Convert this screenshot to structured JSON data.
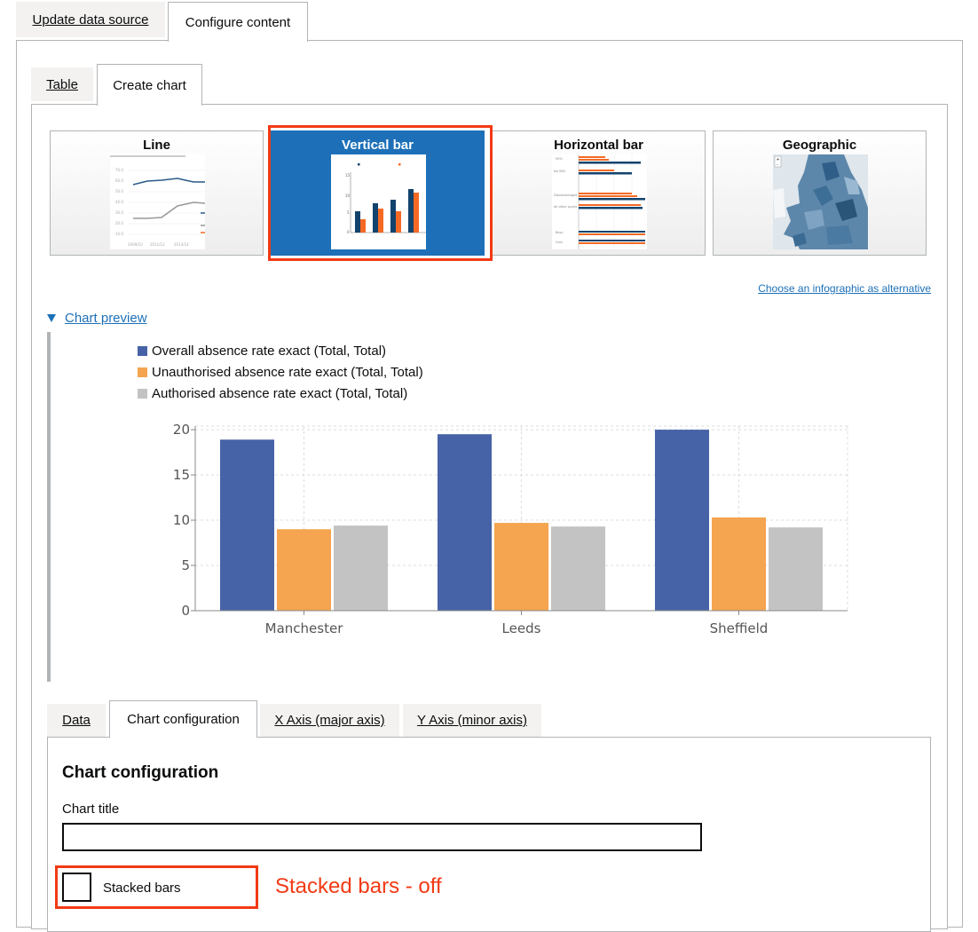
{
  "top_tabs": [
    {
      "label": "Update data source"
    },
    {
      "label": "Configure content"
    }
  ],
  "inner_tabs": [
    {
      "label": "Table"
    },
    {
      "label": "Create chart"
    }
  ],
  "chart_types": [
    {
      "label": "Line"
    },
    {
      "label": "Vertical bar",
      "selected": true
    },
    {
      "label": "Horizontal bar"
    },
    {
      "label": "Geographic"
    }
  ],
  "infographic_link": "Choose an infographic as alternative",
  "preview_toggle": "Chart preview",
  "colors": {
    "overall": "#4763a7",
    "unauthorised": "#f5a450",
    "authorised": "#c3c3c3",
    "selected_card": "#1d70b8",
    "annotation": "#f23a14",
    "link": "#1d70b8"
  },
  "chart_data": {
    "type": "bar",
    "categories": [
      "Manchester",
      "Leeds",
      "Sheffield"
    ],
    "series": [
      {
        "name": "Overall absence rate exact (Total, Total)",
        "values": [
          18.9,
          19.5,
          20.0
        ]
      },
      {
        "name": "Unauthorised absence rate exact (Total, Total)",
        "values": [
          9.0,
          9.7,
          10.3
        ]
      },
      {
        "name": "Authorised absence rate exact (Total, Total)",
        "values": [
          9.4,
          9.3,
          9.2
        ]
      }
    ],
    "yticks": [
      "0",
      "5",
      "10",
      "15",
      "20"
    ],
    "ylim": [
      0,
      20.4
    ],
    "grid": true,
    "legend_position": "top-left"
  },
  "config_tabs": [
    {
      "label": "Data"
    },
    {
      "label": "Chart configuration"
    },
    {
      "label": "X Axis (major axis)"
    },
    {
      "label": "Y Axis (minor axis)"
    }
  ],
  "config": {
    "heading": "Chart configuration",
    "title_label": "Chart title",
    "title_value": "",
    "stacked_label": "Stacked bars",
    "stacked_checked": false
  },
  "annotation_text": "Stacked bars - off"
}
